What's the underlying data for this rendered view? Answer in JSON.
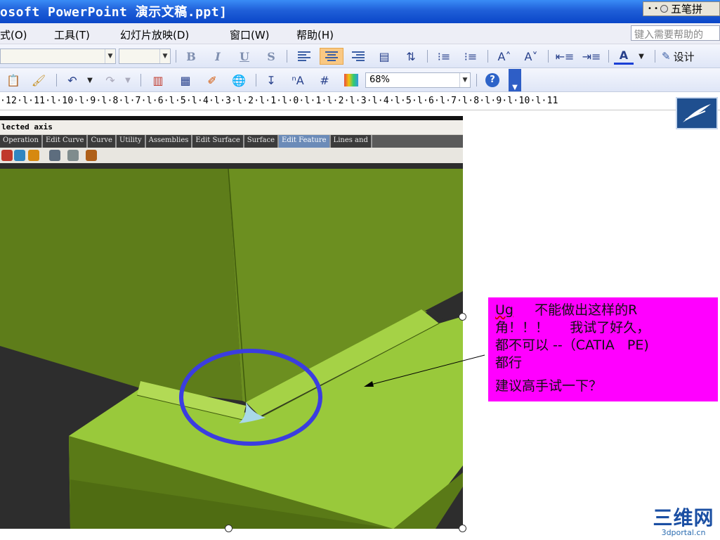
{
  "window": {
    "title": "osoft PowerPoint 演示文稿.ppt]",
    "ime_label": "五笔拼"
  },
  "menu": {
    "items": [
      {
        "label": "式(O)"
      },
      {
        "label": "工具(T)"
      },
      {
        "label": "幻灯片放映(D)"
      },
      {
        "label": "窗口(W)"
      },
      {
        "label": "帮助(H)"
      }
    ],
    "help_placeholder": "键入需要帮助的"
  },
  "toolbar_format": {
    "bold": "B",
    "italic": "I",
    "underline": "U",
    "shadow": "S",
    "font_color": "A",
    "design_label": "设计"
  },
  "toolbar_standard": {
    "zoom_value": "68%"
  },
  "ruler": {
    "text": "·12·l·11·l·10·l·9·l·8·l·7·l·6·l·5·l·4·l·3·l·2·l·1·l·0·l·1·l·2·l·3·l·4·l·5·l·6·l·7·l·8·l·9·l·10·l·11"
  },
  "cad_app": {
    "status_text": "lected axis",
    "tabs": [
      {
        "label": "Operation"
      },
      {
        "label": "Edit Curve"
      },
      {
        "label": "Curve"
      },
      {
        "label": "Utility"
      },
      {
        "label": "Assemblies"
      },
      {
        "label": "Edit Surface"
      },
      {
        "label": "Surface"
      },
      {
        "label": "Edit Feature",
        "selected": true
      },
      {
        "label": "Lines and"
      }
    ],
    "colors": {
      "surface_dark": "#5f7f1b",
      "surface_light": "#97c83a",
      "highlight_circle": "#3b3de0"
    }
  },
  "callout": {
    "line1_a": "Ug",
    "line1_b": "不能做出这样的R",
    "line2": "角！！！     我试了好久，",
    "line3": "都不可以 --（CATIA   PE)",
    "line4": "都行",
    "line5": "建议高手试一下？",
    "color": "#ff00ff"
  },
  "watermark": {
    "big": "三维网",
    "small": "3dportal.cn"
  }
}
